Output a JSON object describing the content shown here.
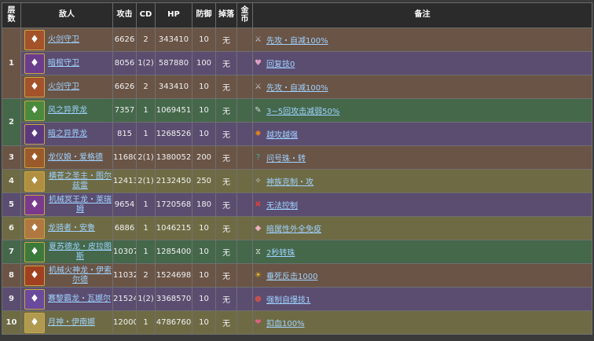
{
  "headers": {
    "floor": "层数",
    "enemy": "敌人",
    "attack": "攻击",
    "cd": "CD",
    "hp": "HP",
    "defense": "防御",
    "drop": "掉落",
    "coin": "金币",
    "note": "备注"
  },
  "rows": [
    {
      "floor": "1",
      "floor_rowspan": 3,
      "name": "火剑守卫",
      "attack": "6626",
      "cd": "2",
      "hp": "343410",
      "defense": "10",
      "drop": "无",
      "note": "先攻・自减100%",
      "style": "brown",
      "avatar_icon": "fire-warrior-icon",
      "avatar_color": "#a3522a",
      "skill_icon": "sword-skill-icon",
      "skill_color": "#c8c8c8"
    },
    {
      "floor": "",
      "name": "暗棺守卫",
      "attack": "8056",
      "cd": "1(2)",
      "hp": "587880",
      "defense": "100",
      "drop": "无",
      "note": "回复技0",
      "style": "purple",
      "avatar_icon": "dark-guard-icon",
      "avatar_color": "#6b3c8c",
      "skill_icon": "heal-skill-icon",
      "skill_color": "#e0a0c0"
    },
    {
      "floor": "",
      "name": "火剑守卫",
      "attack": "6626",
      "cd": "2",
      "hp": "343410",
      "defense": "10",
      "drop": "无",
      "note": "先攻・自减100%",
      "style": "brown",
      "avatar_icon": "fire-warrior-icon",
      "avatar_color": "#a3522a",
      "skill_icon": "sword-skill-icon",
      "skill_color": "#c8c8c8"
    },
    {
      "floor": "2",
      "floor_rowspan": 2,
      "name": "风之异界龙",
      "attack": "7357",
      "cd": "1",
      "hp": "1069451",
      "defense": "10",
      "drop": "无",
      "note": "3~5回攻击减弱50%",
      "style": "green",
      "avatar_icon": "wind-dragon-icon",
      "avatar_color": "#4a8a3c",
      "skill_icon": "pen-skill-icon",
      "skill_color": "#d8d8d8"
    },
    {
      "floor": "",
      "name": "暗之异界龙",
      "attack": "815",
      "cd": "1",
      "hp": "1268526",
      "defense": "10",
      "drop": "无",
      "note": "越攻越强",
      "style": "purple",
      "avatar_icon": "dark-dragon-icon",
      "avatar_color": "#5a3a7c",
      "skill_icon": "fire-skill-icon",
      "skill_color": "#e08020"
    },
    {
      "floor": "3",
      "floor_rowspan": 1,
      "name": "龙仪娘・爱格德",
      "attack": "11680",
      "cd": "2(1)",
      "hp": "1380052",
      "defense": "200",
      "drop": "无",
      "note": "问号珠・转",
      "style": "brown",
      "avatar_icon": "dragon-girl-icon",
      "avatar_color": "#9a5a2a",
      "skill_icon": "question-skill-icon",
      "skill_color": "#40b0a0"
    },
    {
      "floor": "4",
      "floor_rowspan": 1,
      "name": "横苍之圣主・图尔兹雷",
      "attack": "12413",
      "cd": "2(1)",
      "hp": "2132450",
      "defense": "250",
      "drop": "无",
      "note": "神族克制・攻",
      "style": "olive",
      "avatar_icon": "holy-lord-icon",
      "avatar_color": "#b09040",
      "skill_icon": "wing-skill-icon",
      "skill_color": "#d0d0d0"
    },
    {
      "floor": "5",
      "floor_rowspan": 1,
      "name": "机械冥王龙・莱瑞姆",
      "attack": "9654",
      "cd": "1",
      "hp": "1720568",
      "defense": "180",
      "drop": "无",
      "note": "无法控制",
      "style": "purple",
      "avatar_icon": "mech-dragon-icon",
      "avatar_color": "#7a3a8c",
      "skill_icon": "cross-skill-icon",
      "skill_color": "#d04040"
    },
    {
      "floor": "6",
      "floor_rowspan": 1,
      "name": "龙骑者・安鲁",
      "attack": "6886",
      "cd": "1",
      "hp": "1046215",
      "defense": "10",
      "drop": "无",
      "note": "暗属性外全免疫",
      "style": "olive",
      "avatar_icon": "dragon-rider-icon",
      "avatar_color": "#b07840",
      "skill_icon": "shield-skill-icon",
      "skill_color": "#f0b0c0"
    },
    {
      "floor": "7",
      "floor_rowspan": 1,
      "name": "夏苏德龙・皮拉图斯",
      "attack": "10307",
      "cd": "1",
      "hp": "1285400",
      "defense": "10",
      "drop": "无",
      "note": "2秒转珠",
      "style": "green",
      "avatar_icon": "green-dragon-icon",
      "avatar_color": "#3c7a3c",
      "skill_icon": "timer-skill-icon",
      "skill_color": "#e0e0e0"
    },
    {
      "floor": "8",
      "floor_rowspan": 1,
      "name": "机械火神龙・伊索尔德",
      "attack": "11032",
      "cd": "2",
      "hp": "1524698",
      "defense": "10",
      "drop": "无",
      "note": "垂死反击1000",
      "style": "brown",
      "avatar_icon": "fire-mech-dragon-icon",
      "avatar_color": "#a04020",
      "skill_icon": "sun-skill-icon",
      "skill_color": "#f0c020"
    },
    {
      "floor": "9",
      "floor_rowspan": 1,
      "name": "赛黎霸龙・瓦娜尔",
      "attack": "21524",
      "cd": "1(2)",
      "hp": "3368570",
      "defense": "10",
      "drop": "无",
      "note": "强制自爆技1",
      "style": "purple",
      "avatar_icon": "dark-overlord-icon",
      "avatar_color": "#6a4a9c",
      "skill_icon": "bomb-skill-icon",
      "skill_color": "#c05050"
    },
    {
      "floor": "10",
      "floor_rowspan": 1,
      "name": "月神・伊南娜",
      "attack": "12000",
      "cd": "1",
      "hp": "4786760",
      "defense": "10",
      "drop": "无",
      "note": "扣血100%",
      "style": "olive",
      "avatar_icon": "moon-goddess-icon",
      "avatar_color": "#b09a50",
      "skill_icon": "drain-skill-icon",
      "skill_color": "#e06080"
    }
  ]
}
